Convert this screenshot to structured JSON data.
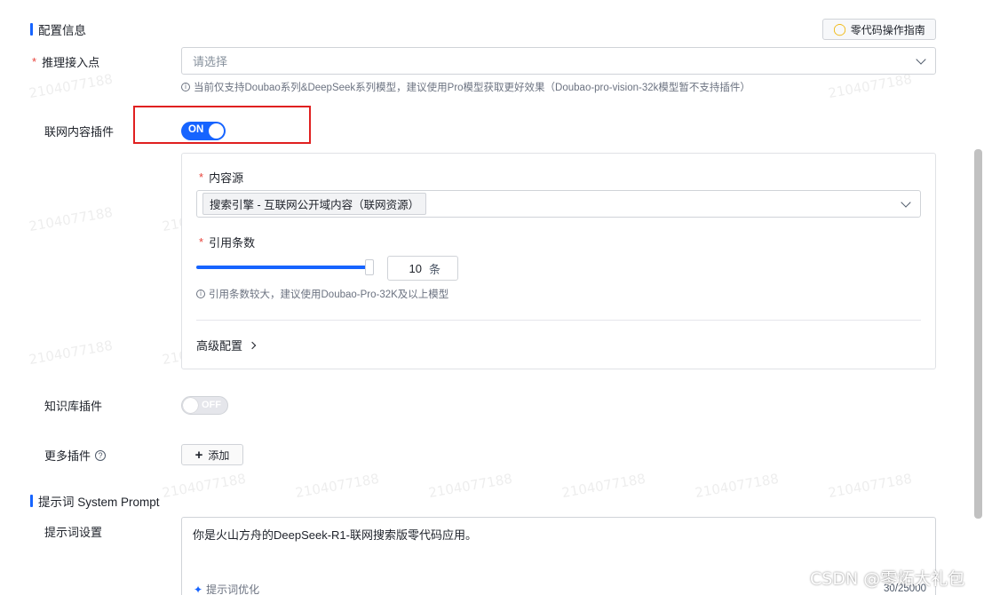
{
  "watermark": "2104077188",
  "config_section": {
    "title": "配置信息",
    "guide_button": "零代码操作指南"
  },
  "inference_endpoint": {
    "label": "推理接入点",
    "placeholder": "请选择",
    "hint": "当前仅支持Doubao系列&DeepSeek系列模型，建议使用Pro模型获取更好效果（Doubao-pro-vision-32k模型暂不支持插件）"
  },
  "web_plugin": {
    "label": "联网内容插件",
    "toggle": "ON",
    "content_source": {
      "label": "内容源",
      "selected_tag": "搜索引擎 - 互联网公开域内容（联网资源）"
    },
    "citation_count": {
      "label": "引用条数",
      "value": "10",
      "unit": "条",
      "slider_fraction": 1.0,
      "hint": "引用条数较大，建议使用Doubao-Pro-32K及以上模型"
    },
    "advanced": "高级配置"
  },
  "knowledge_plugin": {
    "label": "知识库插件",
    "toggle": "OFF"
  },
  "more_plugins": {
    "label": "更多插件",
    "add_button": "添加"
  },
  "prompt_section": {
    "title": "提示词 System Prompt",
    "label": "提示词设置",
    "text": "你是火山方舟的DeepSeek-R1-联网搜索版零代码应用。",
    "optimize": "提示词优化",
    "count": "30/25000"
  },
  "overlay": "CSDN @零炻大礼包",
  "colors": {
    "accent": "#1664ff",
    "required": "#e8443c",
    "highlight_box": "#e02020"
  }
}
